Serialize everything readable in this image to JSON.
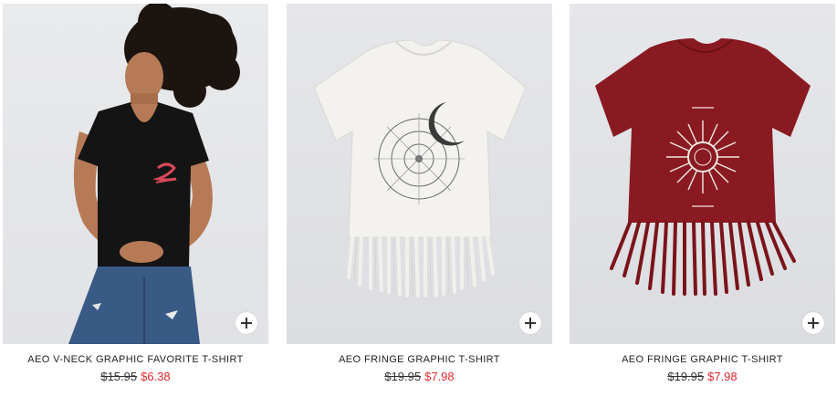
{
  "products": [
    {
      "name": "AEO V-NECK GRAPHIC FAVORITE T-SHIRT",
      "old_price": "$15.95",
      "sale_price": "$6.38",
      "shirt_color": "#141414",
      "graphic_color": "#d9485a",
      "image": "model-black-vneck-tshirt",
      "add_icon": "plus-icon"
    },
    {
      "name": "AEO FRINGE GRAPHIC T-SHIRT",
      "old_price": "$19.95",
      "sale_price": "$7.98",
      "shirt_color": "#f3f2ef",
      "graphic_color": "#3a3a3a",
      "image": "white-fringe-graphic-tshirt",
      "add_icon": "plus-icon"
    },
    {
      "name": "AEO FRINGE GRAPHIC T-SHIRT",
      "old_price": "$19.95",
      "sale_price": "$7.98",
      "shirt_color": "#8a1a22",
      "graphic_color": "#f2e8e0",
      "image": "red-fringe-graphic-tshirt",
      "add_icon": "plus-icon"
    }
  ],
  "colors": {
    "sale": "#e0282e",
    "text": "#222222",
    "image_bg": "#e6e7ea"
  }
}
